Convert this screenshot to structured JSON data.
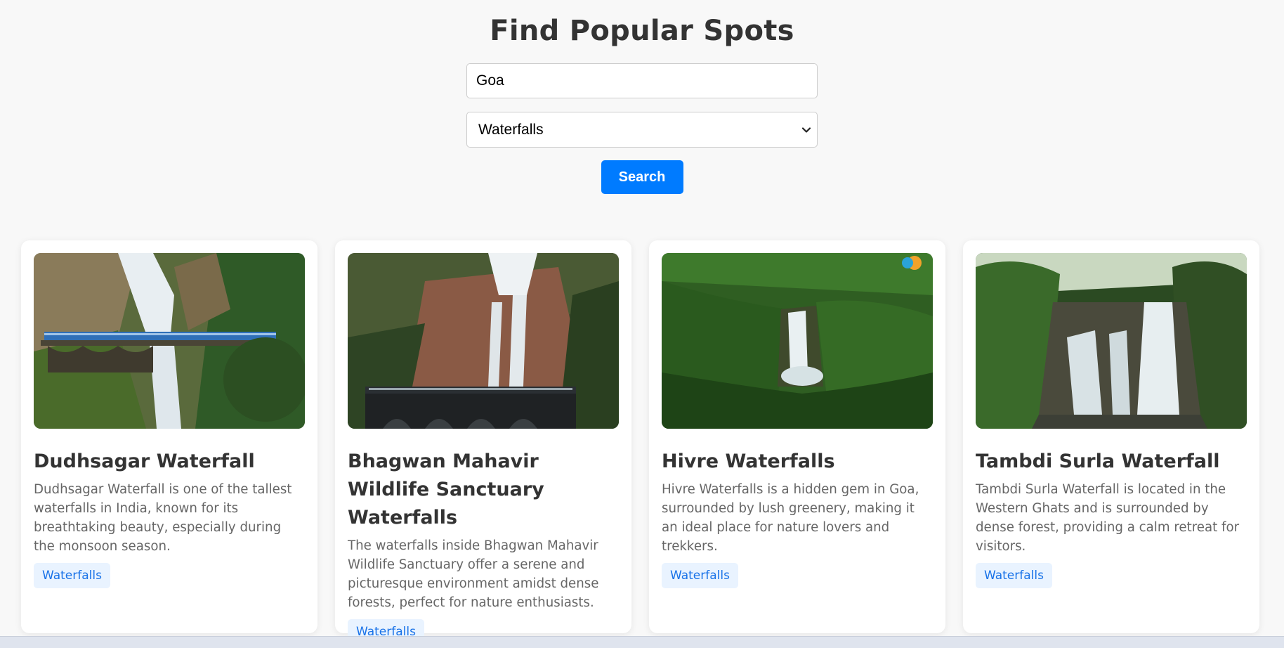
{
  "header": {
    "title": "Find Popular Spots"
  },
  "search": {
    "query": "Goa",
    "category": "Waterfalls",
    "button_label": "Search"
  },
  "cards": [
    {
      "title": "Dudhsagar Waterfall",
      "description": "Dudhsagar Waterfall is one of the tallest waterfalls in India, known for its breathtaking beauty, especially during the monsoon season.",
      "tag": "Waterfalls"
    },
    {
      "title": "Bhagwan Mahavir Wildlife Sanctuary Waterfalls",
      "description": "The waterfalls inside Bhagwan Mahavir Wildlife Sanctuary offer a serene and picturesque environment amidst dense forests, perfect for nature enthusiasts.",
      "tag": "Waterfalls"
    },
    {
      "title": "Hivre Waterfalls",
      "description": "Hivre Waterfalls is a hidden gem in Goa, surrounded by lush greenery, making it an ideal place for nature lovers and trekkers.",
      "tag": "Waterfalls"
    },
    {
      "title": "Tambdi Surla Waterfall",
      "description": "Tambdi Surla Waterfall is located in the Western Ghats and is surrounded by dense forest, providing a calm retreat for visitors.",
      "tag": "Waterfalls"
    }
  ],
  "colors": {
    "accent": "#007bff",
    "tag_bg": "#e9f3ff",
    "tag_text": "#1a73e8",
    "background": "#f8f8f8"
  }
}
